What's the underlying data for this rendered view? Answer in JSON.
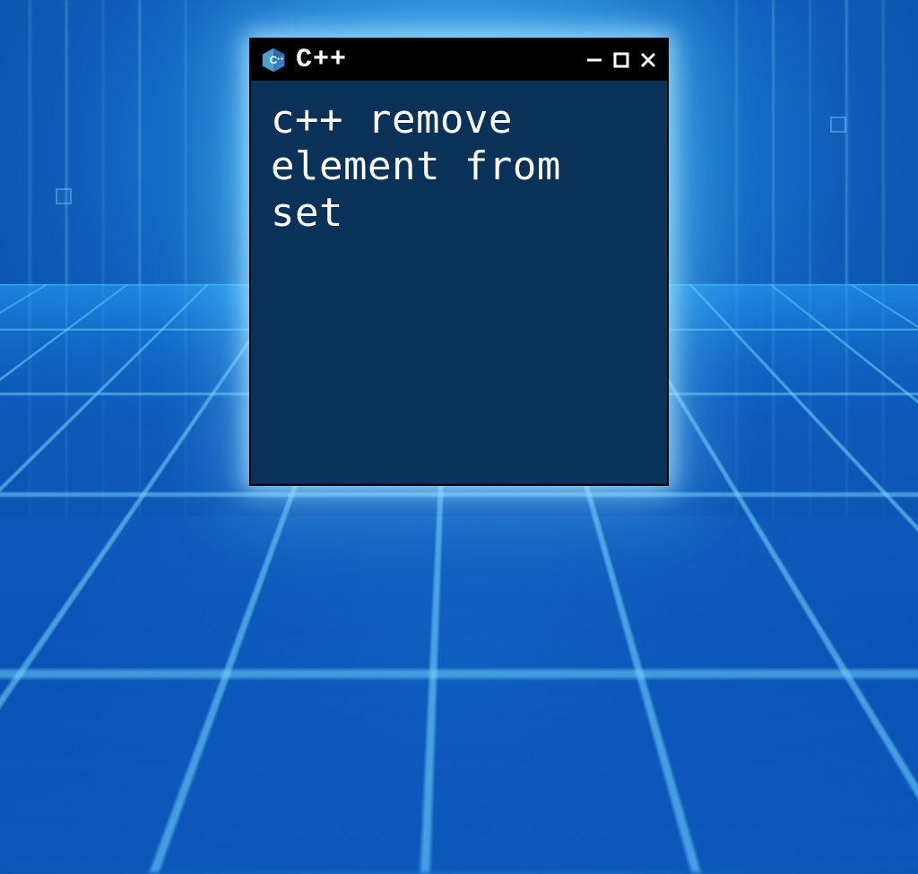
{
  "window": {
    "title": "C++",
    "icon": "cpp-logo",
    "controls": {
      "minimize": "minimize-icon",
      "maximize": "maximize-icon",
      "close": "close-icon"
    }
  },
  "content": {
    "text": "c++ remove element from set"
  },
  "colors": {
    "window_bg": "#0a3258",
    "titlebar_bg": "#000000",
    "text": "#ffffff",
    "glow": "#7fd8ff"
  }
}
